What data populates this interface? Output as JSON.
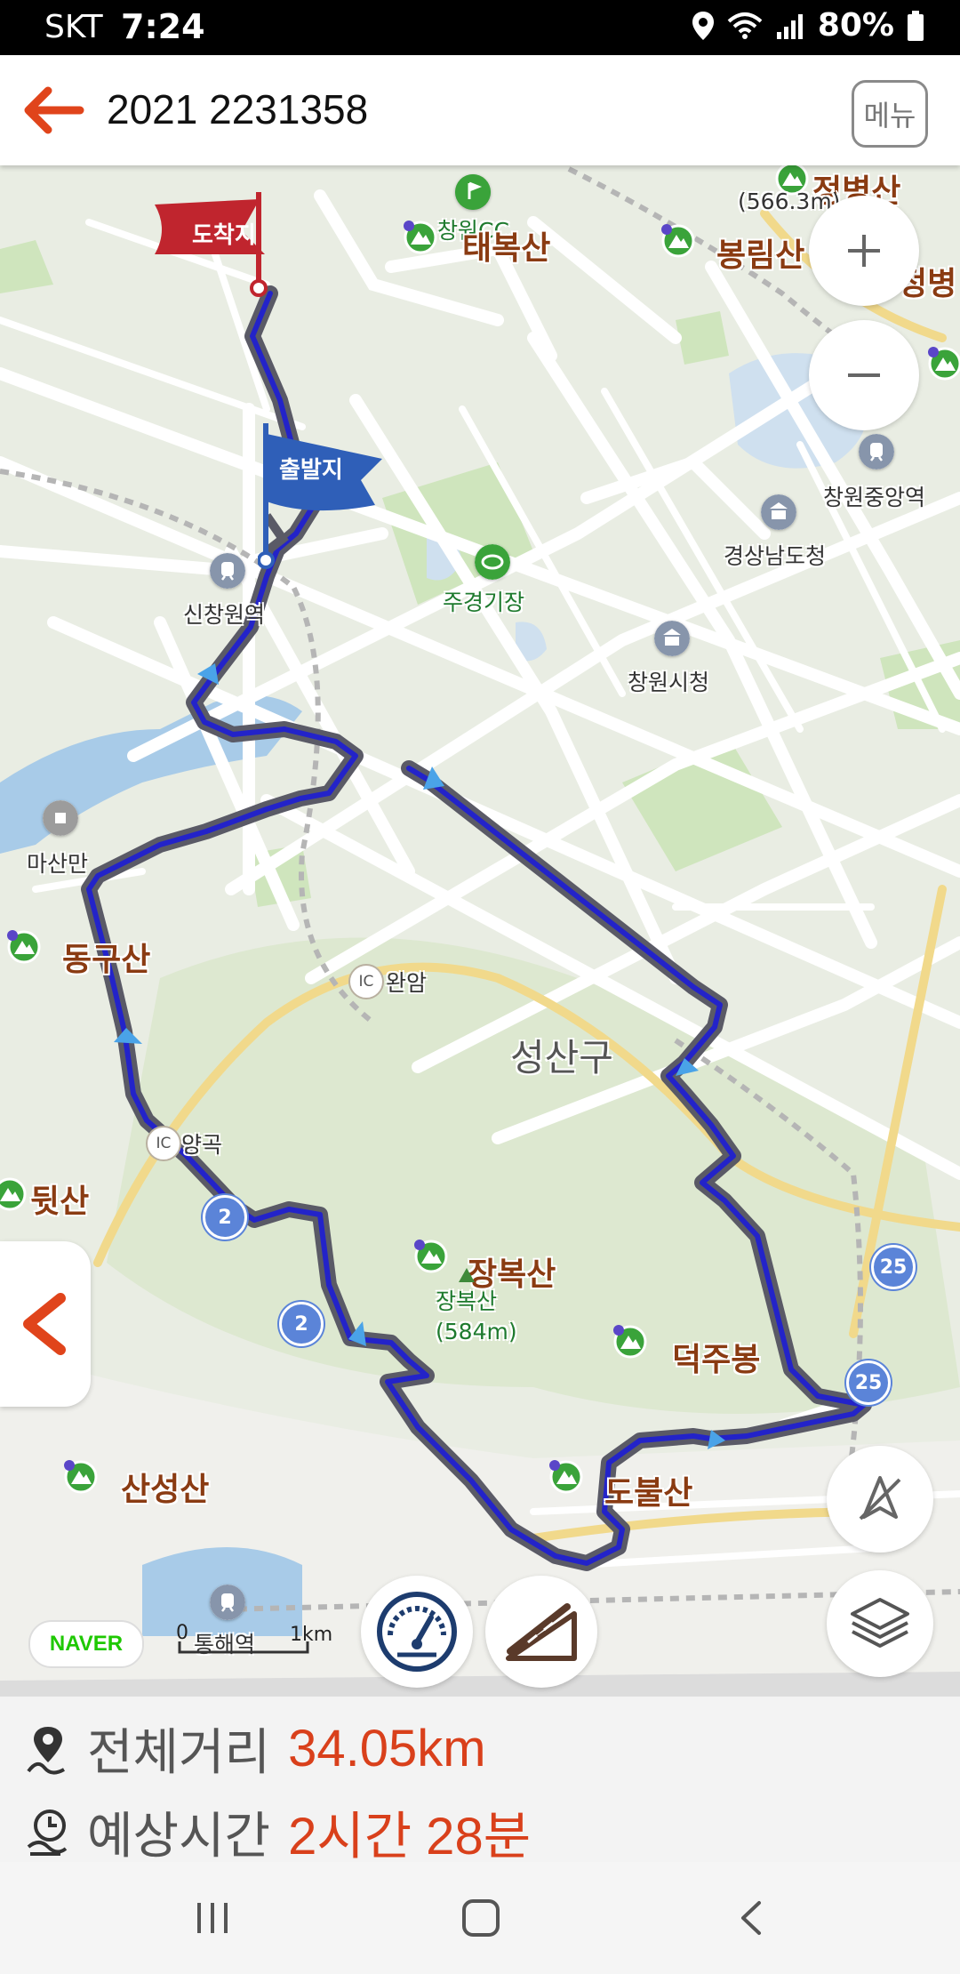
{
  "status_bar": {
    "carrier": "SKT",
    "time": "7:24",
    "battery": "80%"
  },
  "header": {
    "title": "2021 2231358",
    "menu_label": "메뉴"
  },
  "map": {
    "flags": {
      "destination": "도착지",
      "start": "출발지"
    },
    "peaks": {
      "taebok": "태복산",
      "bongrim": "봉림산",
      "jeongbyeong": "정병산",
      "jeongbyeong_height": "(566.3m)",
      "jeongbyeong_cut": "정병",
      "donggu": "동구산",
      "dwit": "뒷산",
      "jangbok": "장복산",
      "jangbok_small": "장복산",
      "jangbok_height": "(584m)",
      "deokju": "덕주봉",
      "sanseong": "산성산",
      "dobul": "도불산"
    },
    "places": {
      "changwon_station": "창원중앙역",
      "gyeongnam_office": "경상남도청",
      "sinchangwon": "신창원역",
      "changwon_city": "창원시청",
      "stadium": "주경기장",
      "masan_bay": "마산만",
      "wanam_ic": "완암",
      "yanggok_ic": "양곡",
      "tonghae": "통해역",
      "changwon_cc": "창원CC",
      "ic_badge": "IC"
    },
    "district": "성산구",
    "road_shields": [
      "2",
      "2",
      "25",
      "25"
    ],
    "scale": {
      "zero": "0",
      "distance": "1km"
    },
    "logo": "NAVER",
    "route_color": "#2323c9"
  },
  "info": {
    "distance_label": "전체거리",
    "distance_value": "34.05km",
    "time_label": "예상시간",
    "time_value": "2시간 28분"
  },
  "colors": {
    "accent": "#d9401b",
    "destination_flag": "#c0252e",
    "start_flag": "#2f5fb8"
  }
}
